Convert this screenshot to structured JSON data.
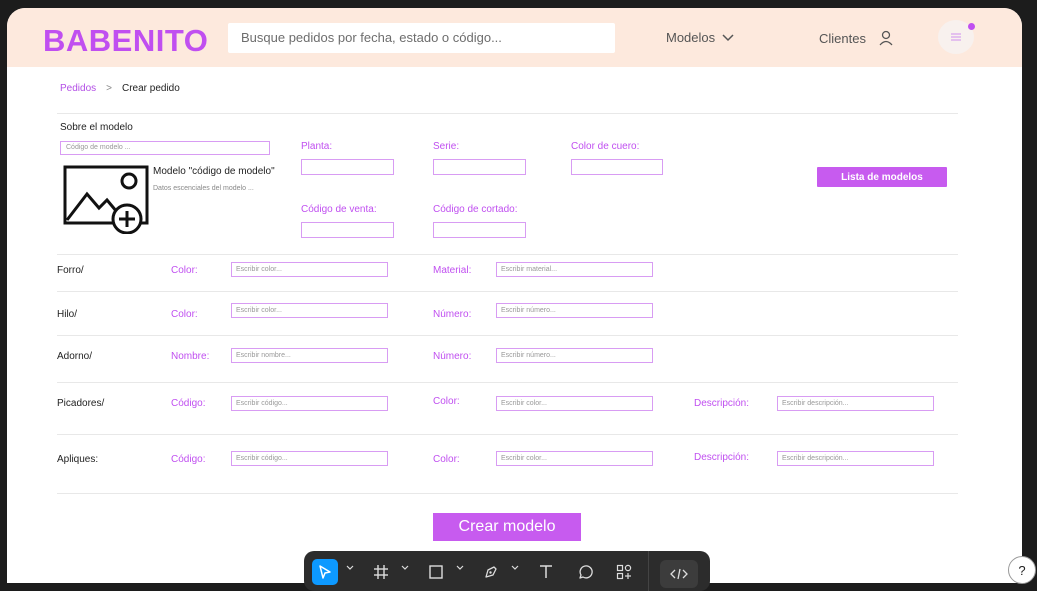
{
  "header": {
    "logo": "BABENITO",
    "search_placeholder": "Busque pedidos por fecha, estado o código...",
    "nav_modelos": "Modelos",
    "nav_clientes": "Clientes"
  },
  "breadcrumb": {
    "link": "Pedidos",
    "separator": ">",
    "current": "Crear pedido"
  },
  "model": {
    "section_title": "Sobre el modelo",
    "code_placeholder": "Código de modelo ...",
    "name": "Modelo \"código de modelo\"",
    "description": "Datos escenciales del modelo ...",
    "fields": {
      "planta": "Planta:",
      "serie": "Serie:",
      "color_cuero": "Color de cuero:",
      "codigo_venta": "Código de venta:",
      "codigo_cortado": "Código de cortado:"
    },
    "lista_button": "Lista de modelos"
  },
  "rows": {
    "forro": {
      "label": "Forro/",
      "f1_label": "Color:",
      "f1_placeholder": "Escribir color...",
      "f2_label": "Material:",
      "f2_placeholder": "Escribir material..."
    },
    "hilo": {
      "label": "Hilo/",
      "f1_label": "Color:",
      "f1_placeholder": "Escribir color...",
      "f2_label": "Número:",
      "f2_placeholder": "Escribir número..."
    },
    "adorno": {
      "label": "Adorno/",
      "f1_label": "Nombre:",
      "f1_placeholder": "Escribir nombre...",
      "f2_label": "Número:",
      "f2_placeholder": "Escribir número..."
    },
    "picadores": {
      "label": "Picadores/",
      "f1_label": "Código:",
      "f1_placeholder": "Escribir código...",
      "f2_label": "Color:",
      "f2_placeholder": "Escribir color...",
      "f3_label": "Descripción:",
      "f3_placeholder": "Escribir descripción..."
    },
    "apliques": {
      "label": "Apliques:",
      "f1_label": "Código:",
      "f1_placeholder": "Escribir código...",
      "f2_label": "Color:",
      "f2_placeholder": "Escribir color...",
      "f3_label": "Descripción:",
      "f3_placeholder": "Escribir descripción..."
    }
  },
  "crear_button": "Crear modelo",
  "toolbar": {
    "tools": [
      "move-tool",
      "frame-tool",
      "rectangle-tool",
      "pen-tool",
      "text-tool",
      "comment-tool",
      "components-tool",
      "dev-mode-tool"
    ],
    "help": "?"
  },
  "colors": {
    "accent": "#c04ff0",
    "button": "#c75bef",
    "header_bg": "#fde9dd",
    "toolbar_bg": "#2c2c2c",
    "active_tool": "#0d99ff"
  }
}
